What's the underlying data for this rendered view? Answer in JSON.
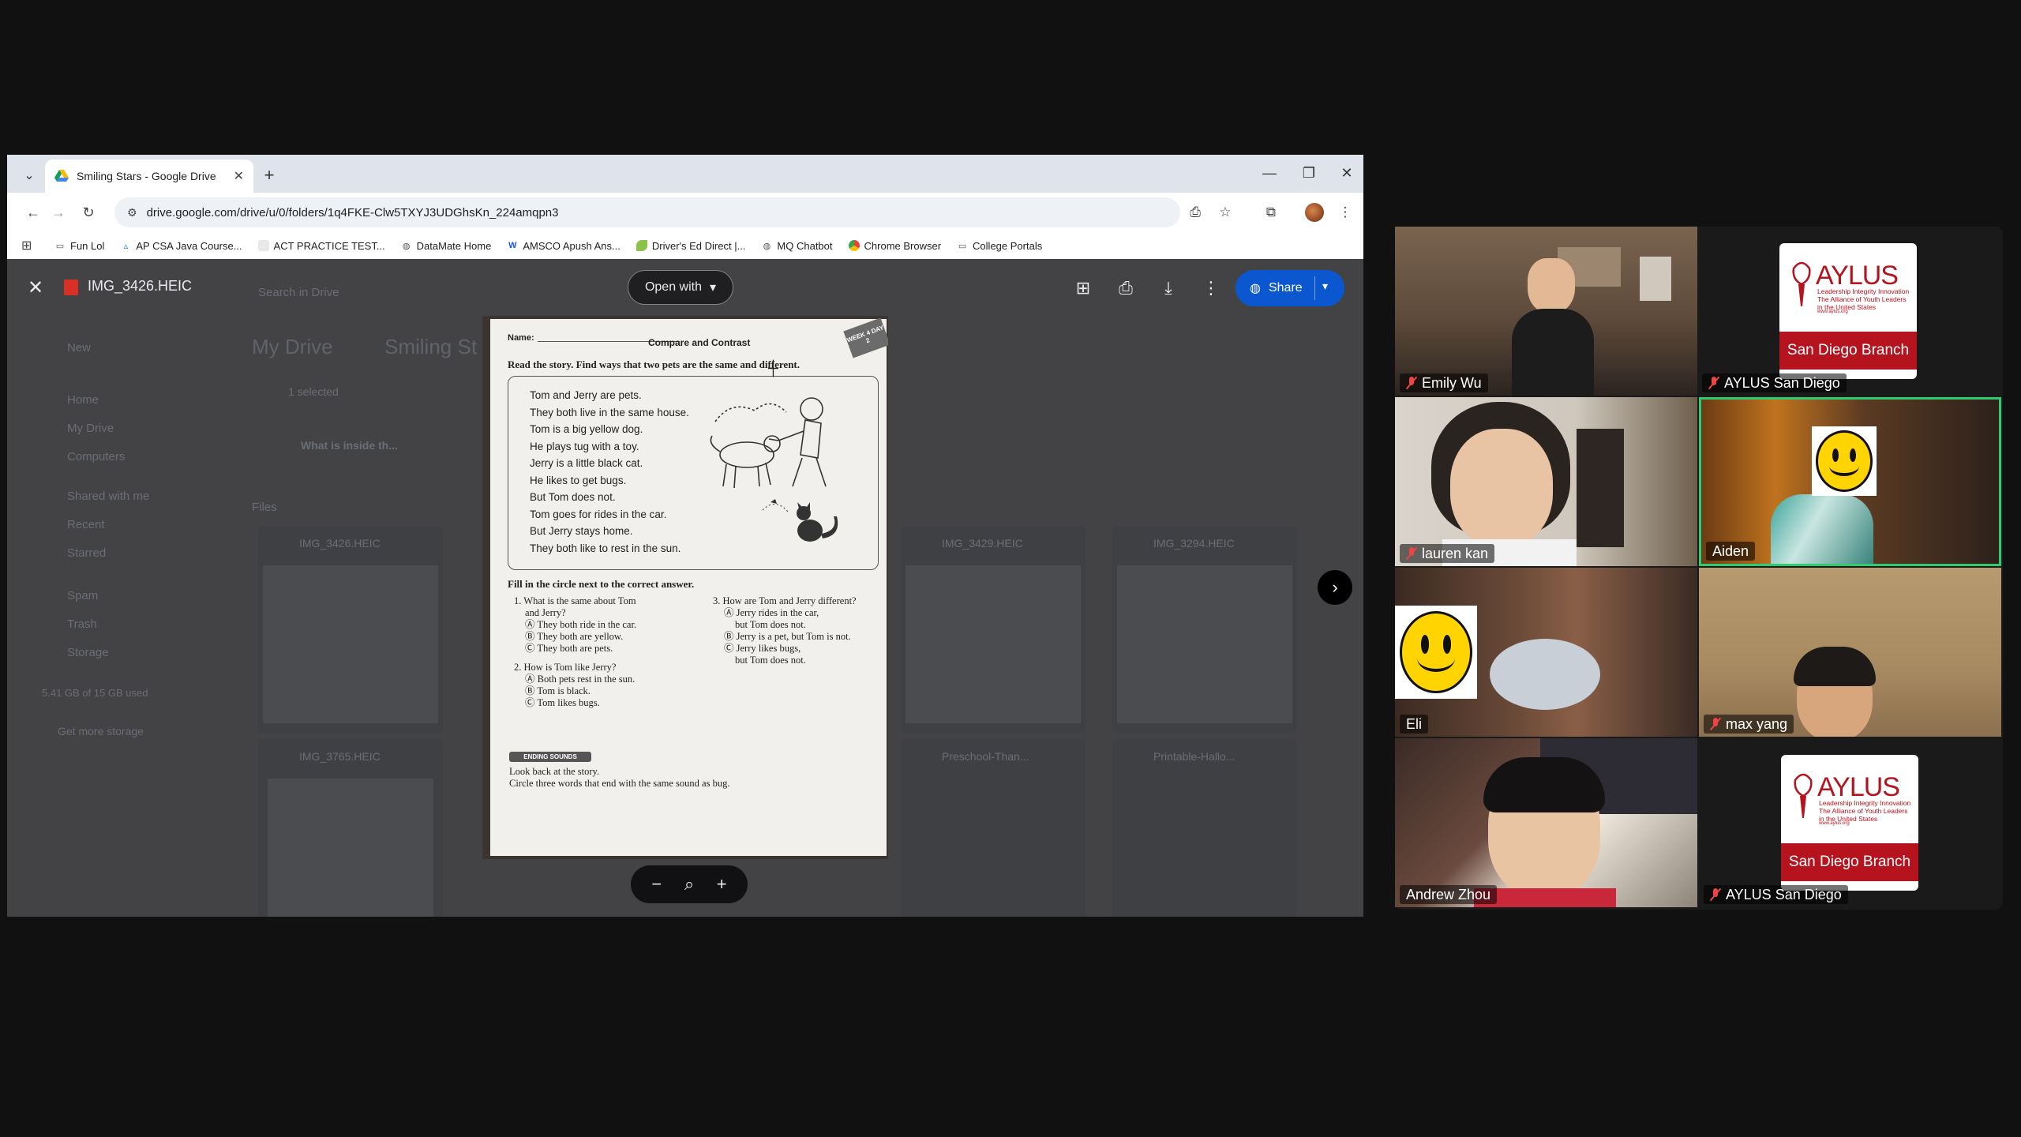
{
  "browser": {
    "tab_title": "Smiling Stars - Google Drive",
    "url": "drive.google.com/drive/u/0/folders/1q4FKE-Clw5TXYJ3UDGhsKn_224amqpn3",
    "bookmarks": [
      {
        "label": "Fun Lol",
        "icon": "folder-icon"
      },
      {
        "label": "AP CSA Java Course...",
        "icon": "course-icon"
      },
      {
        "label": "ACT PRACTICE TEST...",
        "icon": "doc-icon"
      },
      {
        "label": "DataMate Home",
        "icon": "globe-icon"
      },
      {
        "label": "AMSCO Apush Ans...",
        "icon": "w-icon"
      },
      {
        "label": "Driver's Ed Direct |...",
        "icon": "leaf-icon"
      },
      {
        "label": "MQ Chatbot",
        "icon": "globe-icon"
      },
      {
        "label": "Chrome Browser",
        "icon": "chrome-icon"
      },
      {
        "label": "College Portals",
        "icon": "folder-icon"
      }
    ]
  },
  "viewer": {
    "file_name": "IMG_3426.HEIC",
    "open_with": "Open with",
    "share": "Share"
  },
  "drive_background": {
    "new": "New",
    "search_placeholder": "Search in Drive",
    "nav": [
      "Home",
      "My Drive",
      "Computers",
      "Shared with me",
      "Recent",
      "Starred",
      "Spam",
      "Trash",
      "Storage"
    ],
    "storage_text": "5.41 GB of 15 GB used",
    "get_storage": "Get more storage",
    "breadcrumb_root": "My Drive",
    "breadcrumb_folder": "Smiling St",
    "selected": "1 selected",
    "folder_name": "What is inside th...",
    "files_label": "Files",
    "files": [
      "IMG_3426.HEIC",
      "IMG_3429.HEIC",
      "IMG_3294.HEIC",
      "IMG_3765.HEIC",
      "Preschool-Than...",
      "Printable-Hallo..."
    ]
  },
  "worksheet": {
    "name_label": "Name:",
    "compare_label": "Compare and Contrast",
    "week_badge": "WEEK 4 DAY 2",
    "instruction": "Read the story. Find ways that two pets are the same and different.",
    "story_lines": [
      "Tom and Jerry are pets.",
      "They both live in the same house.",
      "Tom is a big yellow dog.",
      "He plays tug with a toy.",
      "Jerry is a little black cat.",
      "He likes to get bugs.",
      "But Tom does not.",
      "Tom goes for rides in the car.",
      "But Jerry stays home.",
      "They both like to rest in the sun."
    ],
    "fill_in": "Fill in the circle next to the correct answer.",
    "q1": [
      "1. What is the same about Tom",
      "and Jerry?",
      "Ⓐ They both ride in the car.",
      "Ⓑ They both are yellow.",
      "Ⓒ They both are pets."
    ],
    "q3": [
      "3. How are Tom and Jerry different?",
      "Ⓐ Jerry rides in the car,",
      "but Tom does not.",
      "Ⓑ Jerry is a pet, but Tom is not.",
      "Ⓒ Jerry likes bugs,",
      "but Tom does not."
    ],
    "q2": [
      "2. How is Tom like Jerry?",
      "Ⓐ Both pets rest in the sun.",
      "Ⓑ Tom is black.",
      "Ⓒ Tom likes bugs."
    ],
    "ending_sounds": "ENDING SOUNDS",
    "look_back": [
      "Look back at the story.",
      "Circle three words that end with the same sound as bug."
    ]
  },
  "participants": [
    {
      "name": "Emily Wu",
      "muted": true
    },
    {
      "name": "AYLUS San Diego",
      "muted": true
    },
    {
      "name": "lauren kan",
      "muted": true
    },
    {
      "name": "Aiden",
      "muted": false
    },
    {
      "name": "Eli",
      "muted": false
    },
    {
      "name": "max yang",
      "muted": true
    },
    {
      "name": "Andrew Zhou",
      "muted": false
    },
    {
      "name": "AYLUS San Diego",
      "muted": true
    }
  ],
  "aylus_card": {
    "word": "AYLUS",
    "tagline": "Leadership Integrity Innovation The Alliance of Youth Leaders in the United States",
    "url": "www.aylus.org",
    "branch": "San Diego Branch"
  },
  "colors": {
    "share_blue": "#0b57d0",
    "active_speaker_border": "#2ecc71",
    "aylus_red": "#b5141f"
  }
}
